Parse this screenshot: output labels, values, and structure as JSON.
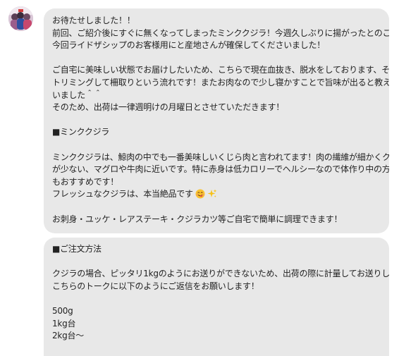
{
  "avatar": {
    "icon": "avatar-photo"
  },
  "messages": [
    {
      "lines": [
        "お待たせしました！！",
        "前回、ご紹介後にすぐに無くなってしまったミンククジラ！今週久しぶりに揚がったとのことで、",
        "今回ライドザシップのお客様用にと産地さんが確保してくださいました！",
        "",
        "ご自宅に美味しい状態でお届けしたいため、こちらで現在血抜き、脱水をしております、その後",
        "トリミングして柵取りという流れです！またお肉なので少し寝かすことで旨味が出ると教えてもら",
        "いました＾＾",
        "そのため、出荷は一律週明けの月曜日とさせていただきます！",
        "",
        "■ミンククジラ",
        "",
        "ミンククジラは、鯨肉の中でも一番美味しいくじら肉と言われてます！肉の繊維が細かくクセ",
        "が少ない、マグロや牛肉に近いです。特に赤身は低カロリーでヘルシーなので体作り中の方に",
        "もおすすめです！",
        "フレッシュなクジラは、本当絶品です",
        "",
        "お刺身・ユッケ・レアステーキ・クジラカツ等ご自宅で簡単に調理できます！"
      ],
      "emoji": [
        "yum-face-emoji",
        "sparkles-emoji"
      ]
    },
    {
      "lines": [
        "■ご注文方法",
        "",
        "クジラの場合、ピッタリ1kgのようにお送りができないため、出荷の際に計量してお送りします☺",
        "こちらのトークに以下のようにご返信をお願いします！",
        "",
        "500g",
        "1kg台",
        "2kg台〜"
      ]
    }
  ]
}
